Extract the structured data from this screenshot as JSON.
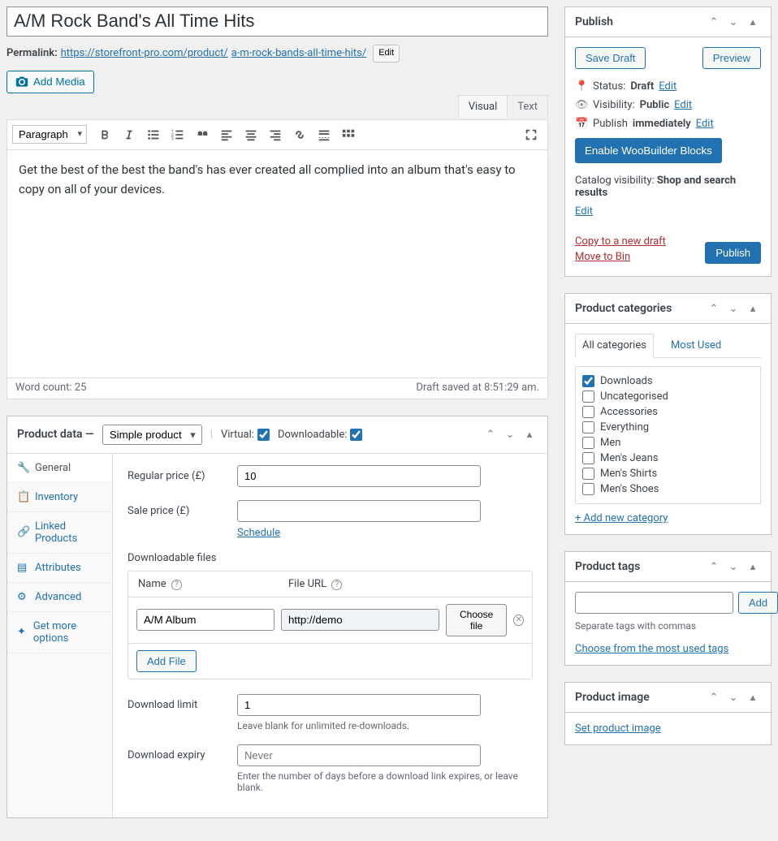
{
  "title": "A/M Rock Band's All Time Hits",
  "permalink": {
    "label": "Permalink:",
    "base": "https://storefront-pro.com/product/",
    "slug": "a-m-rock-bands-all-time-hits/",
    "edit": "Edit"
  },
  "addMedia": "Add Media",
  "editorTabs": {
    "visual": "Visual",
    "text": "Text"
  },
  "paragraphSelect": "Paragraph",
  "content": "Get the best of the best the band's has ever created all complied into an album that's easy to copy on all of your devices.",
  "wordCount": "Word count: 25",
  "draftSaved": "Draft saved at 8:51:29 am.",
  "productData": {
    "title": "Product data",
    "dash": "—",
    "typeSelect": "Simple product",
    "virtualLabel": "Virtual:",
    "downloadableLabel": "Downloadable:",
    "tabs": {
      "general": "General",
      "inventory": "Inventory",
      "linked": "Linked Products",
      "attributes": "Attributes",
      "advanced": "Advanced",
      "getmore": "Get more options"
    },
    "regularPriceLabel": "Regular price (£)",
    "regularPrice": "10",
    "salePriceLabel": "Sale price (£)",
    "salePrice": "",
    "schedule": "Schedule",
    "dlFiles": "Downloadable files",
    "thName": "Name",
    "thUrl": "File URL",
    "fileName": "A/M Album",
    "fileUrl": "http://demo",
    "chooseFile": "Choose file",
    "addFile": "Add File",
    "dlLimitLabel": "Download limit",
    "dlLimit": "1",
    "dlLimitHint": "Leave blank for unlimited re-downloads.",
    "dlExpiryLabel": "Download expiry",
    "dlExpiryPlaceholder": "Never",
    "dlExpiryHint": "Enter the number of days before a download link expires, or leave blank."
  },
  "publish": {
    "title": "Publish",
    "saveDraft": "Save Draft",
    "preview": "Preview",
    "statusLabel": "Status:",
    "statusValue": "Draft",
    "visLabel": "Visibility:",
    "visValue": "Public",
    "pubLabel": "Publish",
    "pubValue": "immediately",
    "edit": "Edit",
    "enableWoo": "Enable WooBuilder Blocks",
    "catalogVis": "Catalog visibility:",
    "catalogVisVal": "Shop and search results",
    "copy": "Copy to a new draft",
    "moveBin": "Move to Bin",
    "publishBtn": "Publish"
  },
  "categories": {
    "title": "Product categories",
    "tabAll": "All categories",
    "tabMost": "Most Used",
    "items": [
      {
        "label": "Downloads",
        "checked": true
      },
      {
        "label": "Uncategorised",
        "checked": false
      },
      {
        "label": "Accessories",
        "checked": false
      },
      {
        "label": "Everything",
        "checked": false
      },
      {
        "label": "Men",
        "checked": false
      },
      {
        "label": "Men's Jeans",
        "checked": false
      },
      {
        "label": "Men's Shirts",
        "checked": false
      },
      {
        "label": "Men's Shoes",
        "checked": false
      }
    ],
    "addNew": "+ Add new category"
  },
  "tags": {
    "title": "Product tags",
    "add": "Add",
    "hint": "Separate tags with commas",
    "choose": "Choose from the most used tags"
  },
  "image": {
    "title": "Product image",
    "set": "Set product image"
  }
}
